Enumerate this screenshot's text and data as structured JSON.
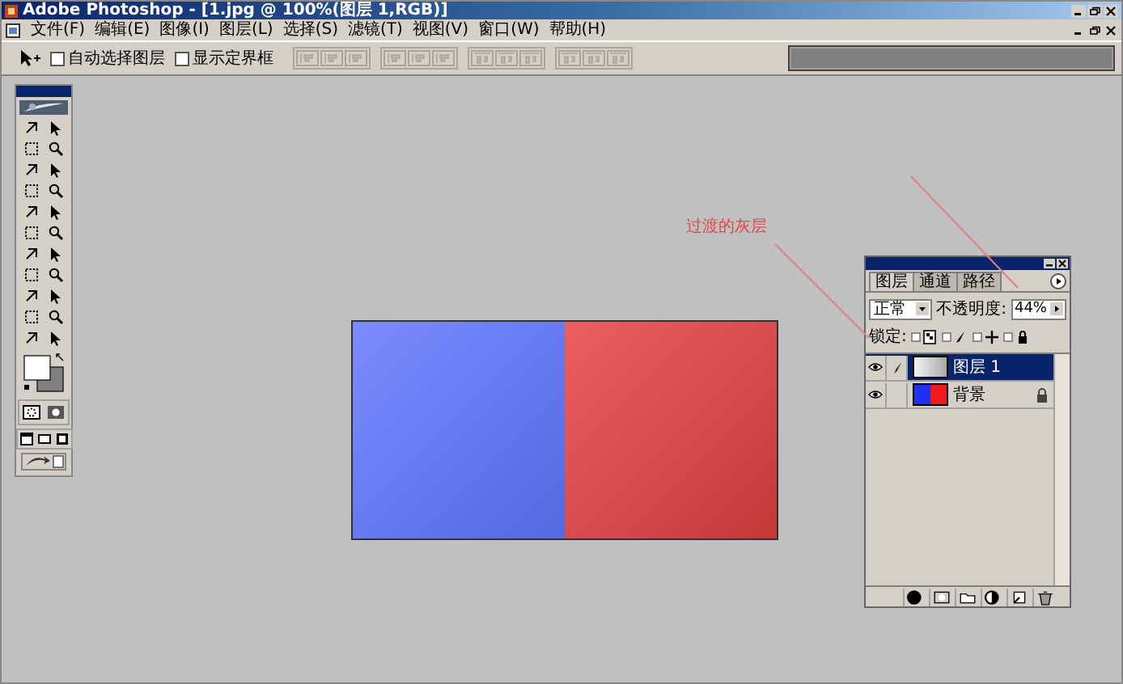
{
  "window": {
    "title": "Adobe Photoshop - [1.jpg @ 100%(图层 1,RGB)]"
  },
  "menu": [
    "文件(F)",
    "编辑(E)",
    "图像(I)",
    "图层(L)",
    "选择(S)",
    "滤镜(T)",
    "视图(V)",
    "窗口(W)",
    "帮助(H)"
  ],
  "options_bar": {
    "checkboxes": [
      {
        "label": "自动选择图层",
        "checked": false
      },
      {
        "label": "显示定界框",
        "checked": false
      }
    ]
  },
  "annotation": {
    "text": "过渡的灰层"
  },
  "layers_panel": {
    "tabs": [
      {
        "label": "图层",
        "selected": true
      },
      {
        "label": "通道",
        "selected": false
      },
      {
        "label": "路径",
        "selected": false
      }
    ],
    "blend_mode": "正常",
    "opacity_label": "不透明度:",
    "opacity": "44%",
    "lock_label": "锁定:",
    "layers": [
      {
        "name": "图层 1",
        "selected": true,
        "visible": true,
        "locked": false,
        "kind": "gradient"
      },
      {
        "name": "背景",
        "selected": false,
        "visible": true,
        "locked": true,
        "kind": "image"
      }
    ]
  }
}
